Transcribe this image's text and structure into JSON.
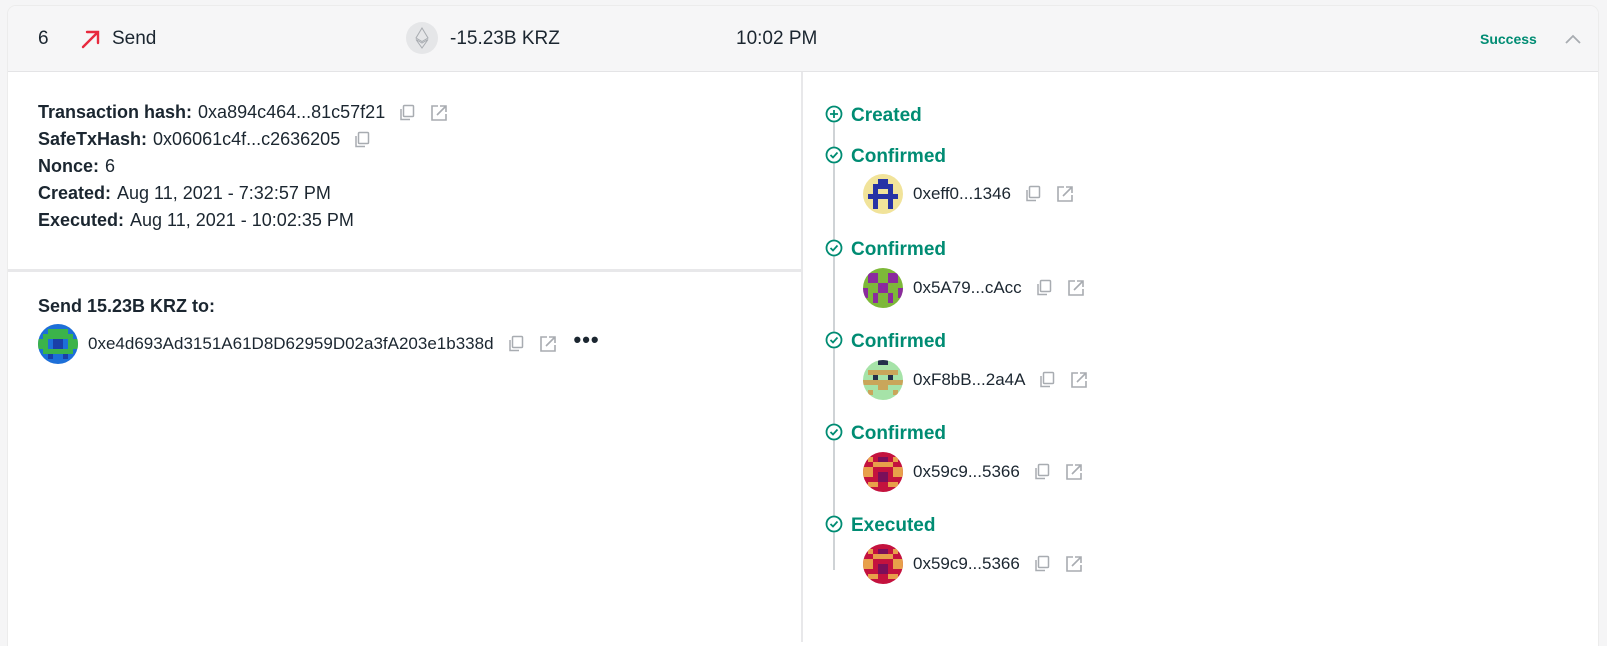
{
  "header": {
    "nonce": "6",
    "type_label": "Send",
    "amount": "-15.23B KRZ",
    "time": "10:02 PM",
    "status": "Success"
  },
  "details": {
    "tx_hash_label": "Transaction hash:",
    "tx_hash": "0xa894c464...81c57f21",
    "safe_tx_hash_label": "SafeTxHash:",
    "safe_tx_hash": "0x06061c4f...c2636205",
    "nonce_label": "Nonce:",
    "nonce": "6",
    "created_label": "Created:",
    "created": "Aug 11, 2021 - 7:32:57 PM",
    "executed_label": "Executed:",
    "executed": "Aug 11, 2021 - 10:02:35 PM"
  },
  "send_to": {
    "title": "Send 15.23B KRZ to:",
    "address": "0xe4d693Ad3151A61D8D62959D02a3fA203e1b338d",
    "more": "•••"
  },
  "timeline": {
    "created": "Created",
    "events": [
      {
        "label": "Confirmed",
        "owner": "0xeff0...1346"
      },
      {
        "label": "Confirmed",
        "owner": "0x5A79...cAcc"
      },
      {
        "label": "Confirmed",
        "owner": "0xF8bB...2a4A"
      },
      {
        "label": "Confirmed",
        "owner": "0x59c9...5366"
      },
      {
        "label": "Executed",
        "owner": "0x59c9...5366"
      }
    ]
  },
  "colors": {
    "accent_green": "#008c73",
    "send_red": "#e8293d",
    "text": "#1b2630"
  },
  "icons": {
    "send": "arrow-up-right-icon",
    "token": "ethereum-icon",
    "copy": "copy-icon",
    "external": "external-link-icon",
    "collapse": "chevron-up-icon",
    "created": "plus-circle-icon",
    "confirmed": "check-circle-icon"
  }
}
